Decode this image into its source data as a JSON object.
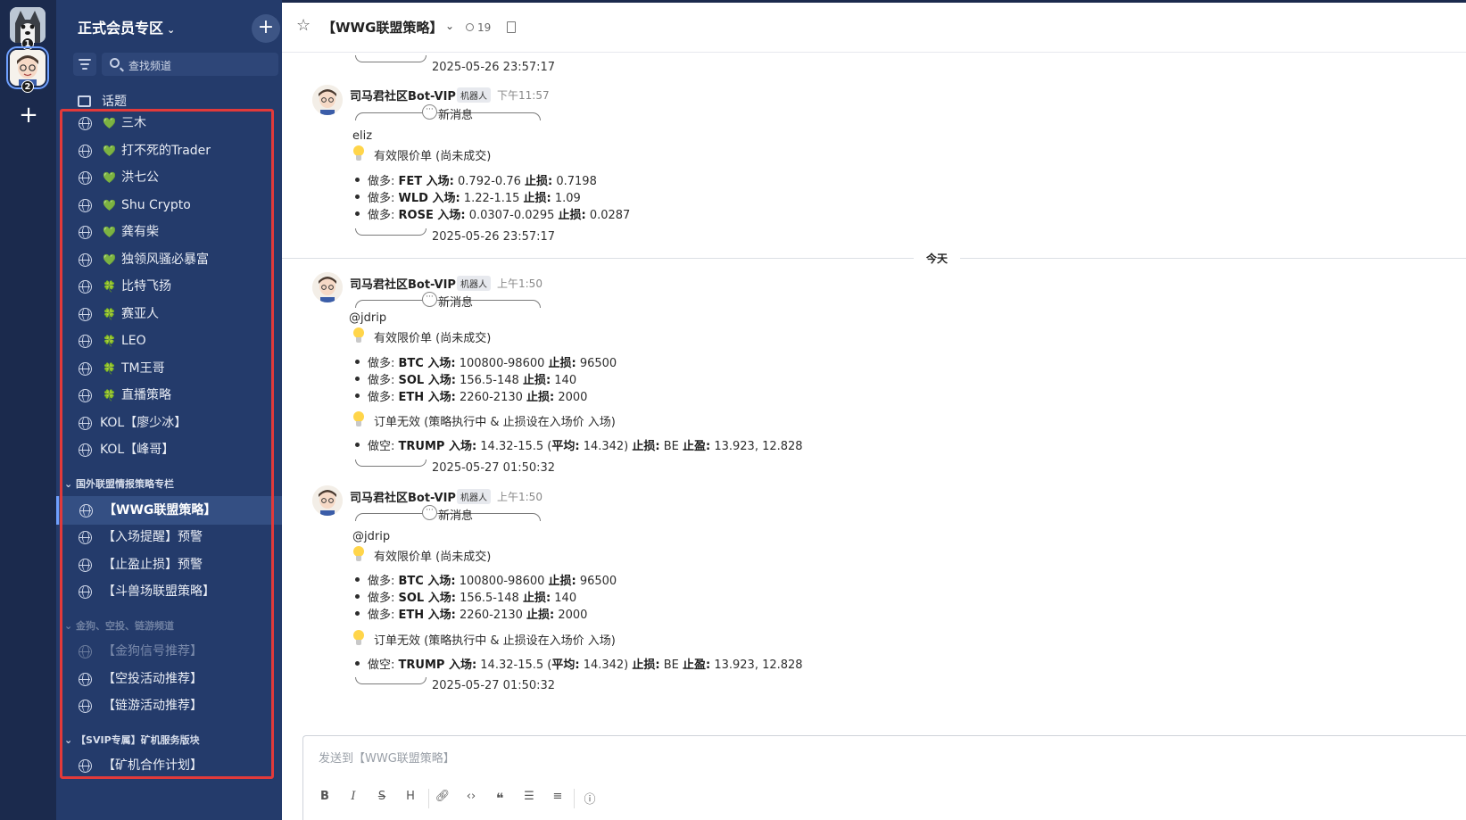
{
  "rail": {
    "servers": [
      {
        "badge": "1"
      },
      {
        "badge": "2"
      }
    ]
  },
  "sidebar": {
    "workspace": "正式会员专区",
    "search_placeholder": "查找频道",
    "topic_label": "话题",
    "channels_top": [
      {
        "label": "三木",
        "emoji": "💚"
      },
      {
        "label": "打不死的Trader",
        "emoji": "💚"
      },
      {
        "label": "洪七公",
        "emoji": "💚"
      },
      {
        "label": "Shu Crypto",
        "emoji": "💚"
      },
      {
        "label": "龚有柴",
        "emoji": "💚"
      },
      {
        "label": "独领风骚必暴富",
        "emoji": "💚"
      },
      {
        "label": "比特飞扬",
        "emoji": "🍀"
      },
      {
        "label": "赛亚人",
        "emoji": "🍀"
      },
      {
        "label": "LEO",
        "emoji": "🍀"
      },
      {
        "label": "TM王哥",
        "emoji": "🍀"
      },
      {
        "label": "直播策略",
        "emoji": "🍀"
      },
      {
        "label": "KOL【廖少冰】",
        "emoji": ""
      },
      {
        "label": "KOL【峰哥】",
        "emoji": ""
      }
    ],
    "category1": "国外联盟情报策略专栏",
    "channels_cat1": [
      {
        "label": "【WWG联盟策略】"
      },
      {
        "label": "【入场提醒】预警"
      },
      {
        "label": "【止盈止损】预警"
      },
      {
        "label": "【斗兽场联盟策略】"
      }
    ],
    "category2": "金狗、空投、链游频道",
    "channels_cat2": [
      {
        "label": "【金狗信号推荐】"
      },
      {
        "label": "【空投活动推荐】"
      },
      {
        "label": "【链游活动推荐】"
      }
    ],
    "category3": "【SVIP专属】矿机服务版块",
    "channels_cat3": [
      {
        "label": "【矿机合作计划】"
      }
    ]
  },
  "header": {
    "title": "【WWG联盟策略】",
    "member_count": "19"
  },
  "messages": {
    "ts0": "2025-05-26 23:57:17",
    "divider": "今天",
    "items": [
      {
        "user": "司马君社区Bot-VIP",
        "tag": "机器人",
        "time": "下午11:57",
        "header": "新消息",
        "mention": "eliz",
        "section1": "有效限价单 (尚未成交)",
        "lines": [
          {
            "p": "做多: ",
            "sym": "FET",
            "e": " 入场:",
            "ev": " 0.792-0.76 ",
            "s": "止损:",
            "sv": " 0.7198"
          },
          {
            "p": "做多: ",
            "sym": "WLD",
            "e": " 入场:",
            "ev": " 1.22-1.15 ",
            "s": "止损:",
            "sv": " 1.09"
          },
          {
            "p": "做多: ",
            "sym": "ROSE",
            "e": " 入场:",
            "ev": " 0.0307-0.0295 ",
            "s": "止损:",
            "sv": " 0.0287"
          }
        ],
        "timestamp": "2025-05-26 23:57:17"
      },
      {
        "user": "司马君社区Bot-VIP",
        "tag": "机器人",
        "time": "上午1:50",
        "header": "新消息",
        "mention": "@jdrip",
        "section1": "有效限价单 (尚未成交)",
        "lines": [
          {
            "p": "做多: ",
            "sym": "BTC",
            "e": " 入场:",
            "ev": " 100800-98600 ",
            "s": "止损:",
            "sv": " 96500"
          },
          {
            "p": "做多: ",
            "sym": "SOL",
            "e": " 入场:",
            "ev": " 156.5-148 ",
            "s": "止损:",
            "sv": " 140"
          },
          {
            "p": "做多: ",
            "sym": "ETH",
            "e": " 入场:",
            "ev": " 2260-2130 ",
            "s": "止损:",
            "sv": " 2000"
          }
        ],
        "section2": "订单无效 (策略执行中 & 止损设在入场价 入场)",
        "short": {
          "p": "做空: ",
          "sym": "TRUMP",
          "e": " 入场:",
          "ev": " 14.32-15.5 (",
          "avg": "平均:",
          "avgv": " 14.342) ",
          "s": "止损:",
          "sv": " BE ",
          "tp": "止盈:",
          "tpv": " 13.923, 12.828"
        },
        "timestamp": "2025-05-27 01:50:32"
      },
      {
        "user": "司马君社区Bot-VIP",
        "tag": "机器人",
        "time": "上午1:50",
        "header": "新消息",
        "mention": "@jdrip",
        "section1": "有效限价单 (尚未成交)",
        "lines": [
          {
            "p": "做多: ",
            "sym": "BTC",
            "e": " 入场:",
            "ev": " 100800-98600 ",
            "s": "止损:",
            "sv": " 96500"
          },
          {
            "p": "做多: ",
            "sym": "SOL",
            "e": " 入场:",
            "ev": " 156.5-148 ",
            "s": "止损:",
            "sv": " 140"
          },
          {
            "p": "做多: ",
            "sym": "ETH",
            "e": " 入场:",
            "ev": " 2260-2130 ",
            "s": "止损:",
            "sv": " 2000"
          }
        ],
        "section2": "订单无效 (策略执行中 & 止损设在入场价 入场)",
        "short": {
          "p": "做空: ",
          "sym": "TRUMP",
          "e": " 入场:",
          "ev": " 14.32-15.5 (",
          "avg": "平均:",
          "avgv": " 14.342) ",
          "s": "止损:",
          "sv": " BE ",
          "tp": "止盈:",
          "tpv": " 13.923, 12.828"
        },
        "timestamp": "2025-05-27 01:50:32"
      }
    ]
  },
  "composer": {
    "placeholder": "发送到【WWG联盟策略】",
    "toolbar": [
      "B",
      "I",
      "S",
      "H",
      "link",
      "code",
      "quote",
      "bullet-list",
      "numbered-list",
      "info"
    ]
  }
}
